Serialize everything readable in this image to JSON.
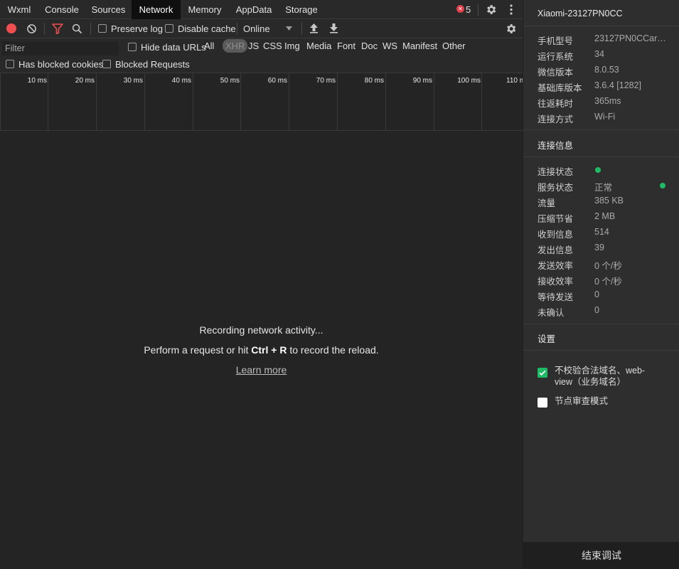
{
  "tabs": [
    {
      "label": "Wxml"
    },
    {
      "label": "Console"
    },
    {
      "label": "Sources"
    },
    {
      "label": "Network",
      "active": true
    },
    {
      "label": "Memory"
    },
    {
      "label": "AppData"
    },
    {
      "label": "Storage"
    }
  ],
  "error_count": "5",
  "toolbar": {
    "preserve_log": "Preserve log",
    "disable_cache": "Disable cache",
    "throttle": "Online"
  },
  "filter": {
    "placeholder": "Filter",
    "hide_data_urls": "Hide data URLs",
    "types": [
      "All",
      "XHR",
      "JS",
      "CSS",
      "Img",
      "Media",
      "Font",
      "Doc",
      "WS",
      "Manifest",
      "Other"
    ],
    "selected_type": "XHR",
    "has_blocked_cookies": "Has blocked cookies",
    "blocked_requests": "Blocked Requests"
  },
  "timeline": {
    "ticks": [
      "10 ms",
      "20 ms",
      "30 ms",
      "40 ms",
      "50 ms",
      "60 ms",
      "70 ms",
      "80 ms",
      "90 ms",
      "100 ms",
      "110 ms"
    ]
  },
  "empty_state": {
    "line1": "Recording network activity...",
    "line2_pre": "Perform a request or hit ",
    "line2_key": "Ctrl + R",
    "line2_post": " to record the reload.",
    "learn_more": "Learn more"
  },
  "device_panel": {
    "title": "Xiaomi-23127PN0CC",
    "device_info": [
      {
        "key": "手机型号",
        "value": "23127PN0CCarm..."
      },
      {
        "key": "运行系统",
        "value": "34"
      },
      {
        "key": "微信版本",
        "value": "8.0.53"
      },
      {
        "key": "基础库版本",
        "value": "3.6.4 [1282]"
      },
      {
        "key": "往返耗时",
        "value": "365ms"
      },
      {
        "key": "连接方式",
        "value": "Wi-Fi"
      }
    ],
    "connection_section": "连接信息",
    "connection_info": [
      {
        "key": "连接状态",
        "value": ""
      },
      {
        "key": "服务状态",
        "value": "正常"
      },
      {
        "key": "流量",
        "value": "385 KB"
      },
      {
        "key": "压缩节省",
        "value": "2 MB"
      },
      {
        "key": "收到信息",
        "value": "514"
      },
      {
        "key": "发出信息",
        "value": "39"
      },
      {
        "key": "发送效率",
        "value": "0 个/秒"
      },
      {
        "key": "接收效率",
        "value": "0 个/秒"
      },
      {
        "key": "等待发送",
        "value": "0"
      },
      {
        "key": "未确认",
        "value": "0"
      }
    ],
    "settings_section": "设置",
    "settings": [
      {
        "label": "不校验合法域名、web-view（业务域名）",
        "checked": true
      },
      {
        "label": "节点审查模式",
        "checked": false
      }
    ],
    "end_debug": "结束调试",
    "status_color": "#1fba66"
  }
}
